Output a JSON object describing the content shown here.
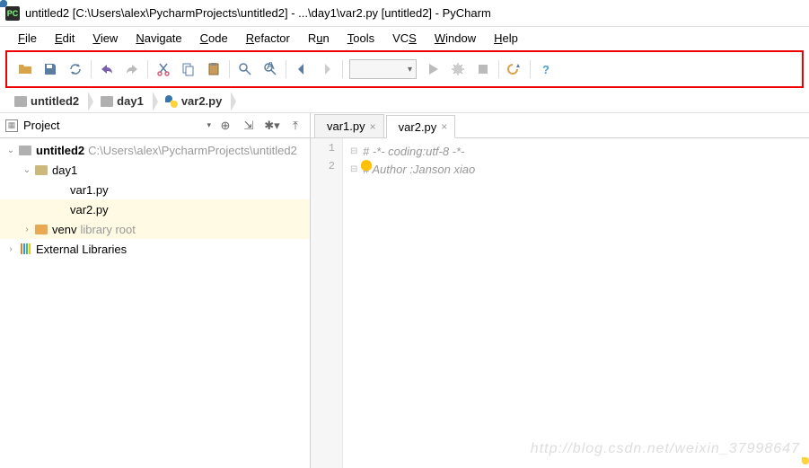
{
  "window": {
    "title": "untitled2 [C:\\Users\\alex\\PycharmProjects\\untitled2] - ...\\day1\\var2.py [untitled2] - PyCharm",
    "app_icon_text": "PC"
  },
  "menubar": {
    "items": [
      "File",
      "Edit",
      "View",
      "Navigate",
      "Code",
      "Refactor",
      "Run",
      "Tools",
      "VCS",
      "Window",
      "Help"
    ]
  },
  "toolbar": {
    "icons": [
      "open-icon",
      "save-icon",
      "sync-icon",
      "undo-icon",
      "redo-icon",
      "cut-icon",
      "copy-icon",
      "paste-icon",
      "find-icon",
      "find-class-icon",
      "back-icon",
      "forward-icon"
    ],
    "run_icons": [
      "run-icon",
      "debug-icon",
      "stop-icon",
      "settings-icon",
      "help-icon"
    ],
    "run_combo_value": ""
  },
  "breadcrumb": {
    "items": [
      {
        "icon": "folder",
        "label": "untitled2"
      },
      {
        "icon": "folder",
        "label": "day1"
      },
      {
        "icon": "python",
        "label": "var2.py"
      }
    ]
  },
  "project_panel": {
    "title": "Project",
    "tree": {
      "root": {
        "label": "untitled2",
        "path": "C:\\Users\\alex\\PycharmProjects\\untitled2"
      },
      "day1": {
        "label": "day1"
      },
      "files": [
        {
          "label": "var1.py"
        },
        {
          "label": "var2.py",
          "selected": true
        }
      ],
      "venv": {
        "label": "venv",
        "note": "library root"
      },
      "ext_libs": {
        "label": "External Libraries"
      }
    }
  },
  "editor": {
    "tabs": [
      {
        "label": "var1.py",
        "active": false
      },
      {
        "label": "var2.py",
        "active": true
      }
    ],
    "lines": [
      {
        "num": "1",
        "text": "# -*- coding:utf-8 -*-"
      },
      {
        "num": "2",
        "text": "# Author :Janson xiao"
      }
    ]
  },
  "watermark": "http://blog.csdn.net/weixin_37998647"
}
